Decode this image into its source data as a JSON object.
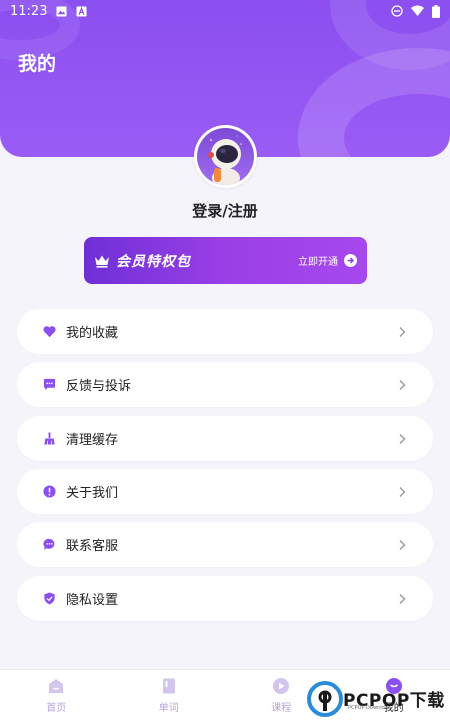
{
  "status_bar": {
    "time": "11:23"
  },
  "header": {
    "title": "我的"
  },
  "profile": {
    "login_label": "登录/注册"
  },
  "vip_banner": {
    "title": "会员特权包",
    "action": "立即开通"
  },
  "menu": [
    {
      "label": "我的收藏",
      "icon": "heart-icon"
    },
    {
      "label": "反馈与投诉",
      "icon": "chat-bubble-icon"
    },
    {
      "label": "清理缓存",
      "icon": "broom-icon"
    },
    {
      "label": "关于我们",
      "icon": "info-icon"
    },
    {
      "label": "联系客服",
      "icon": "message-icon"
    },
    {
      "label": "隐私设置",
      "icon": "shield-icon"
    }
  ],
  "bottom_nav": [
    {
      "label": "首页",
      "icon": "home-icon",
      "active": false
    },
    {
      "label": "单词",
      "icon": "book-icon",
      "active": false
    },
    {
      "label": "课程",
      "icon": "play-icon",
      "active": false
    },
    {
      "label": "我的",
      "icon": "profile-icon",
      "active": true
    }
  ],
  "watermark": {
    "text": "PCPOP下载",
    "sub": "PCPOP Download"
  },
  "colors": {
    "accent": "#8b4ff0",
    "icon": "#8b4ff0",
    "inactive_nav": "#c7b8e8"
  }
}
